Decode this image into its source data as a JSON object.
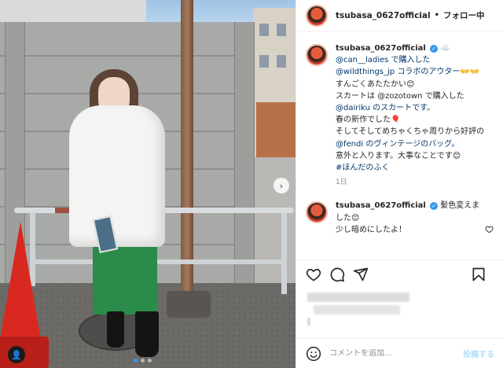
{
  "header": {
    "username": "tsubasa_0627official",
    "separator": "•",
    "follow_label": "フォロー中"
  },
  "caption": {
    "username": "tsubasa_0627official",
    "verified_mark": "✓",
    "trailing_emoji": "☁️",
    "lines": [
      "@can__ladies で購入した",
      "@wildthings_jp コラボのアウター👐👐",
      "すんごくあたたかい😊",
      "スカートは @zozotown で購入した",
      "@dairiku のスカートです。",
      "春の新作でした🎈",
      "そしてそしてめちゃくちゃ周りから好評の",
      "@fendi のヴィンテージのバッグ。",
      "意外と入ります。大事なことです😊",
      "#ほんだのふく"
    ],
    "time": "1日"
  },
  "reply": {
    "username": "tsubasa_0627official",
    "verified_mark": "✓",
    "text_1": "髪色変えま",
    "text_2": "した😊",
    "text_3": "少し暗めにしたよ！"
  },
  "actions": {
    "like_icon": "heart-icon",
    "comment_icon": "comment-icon",
    "share_icon": "share-icon",
    "save_icon": "bookmark-icon"
  },
  "add_comment": {
    "placeholder": "コメントを追加...",
    "post_label": "投稿する"
  },
  "media": {
    "next_arrow": "›",
    "tag_icon": "👤"
  },
  "colors": {
    "link": "#00376b",
    "verified": "#3897f0",
    "post_button": "#b2dffc"
  }
}
